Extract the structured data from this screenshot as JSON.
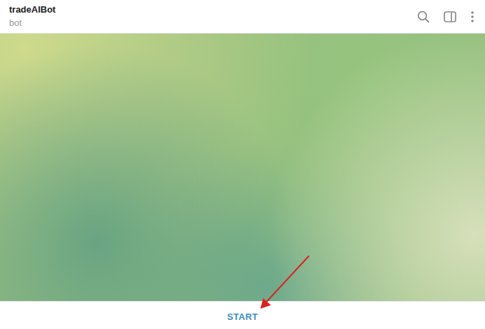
{
  "header": {
    "title": "tradeAIBot",
    "subtitle": "bot"
  },
  "bottom_bar": {
    "button": "START"
  }
}
